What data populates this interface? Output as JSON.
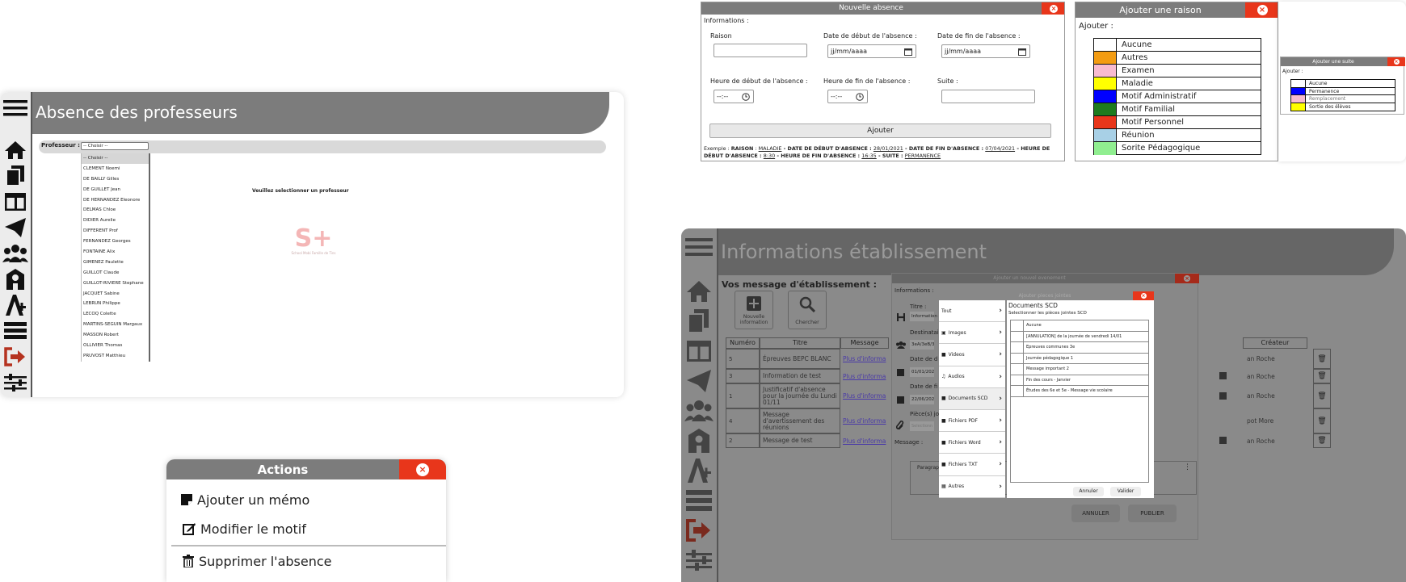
{
  "colors": {
    "accent": "#e8361b",
    "header": "#7c7c7c",
    "sidebar": "#ececec"
  },
  "absence_panel": {
    "title": "Absence des professeurs",
    "prof_label": "Professeur :",
    "select_value": "-- Choisir --",
    "options": [
      "-- Choisir --",
      "CLEMENT Noemi",
      "DE BAILLY Gilles",
      "DE GUILLET Jean",
      "DE HERNANDEZ Eleonore",
      "DELMAS Chloe",
      "DIDIER Aurelie",
      "DIFFERENT Prof",
      "FERNANDEZ Georges",
      "FONTAINE Alix",
      "GIMENEZ Paulette",
      "GUILLOT Claude",
      "GUILLOT-RIVIERE Stephane",
      "JACQUET Sabine",
      "LEBRUN Philippe",
      "LECOQ Colette",
      "MARTINS-SEGUIN Margaux",
      "MASSON Robert",
      "OLLIVIER Thomas",
      "PRUVOST Matthieu"
    ],
    "message": "Veuillez selectionner un professeur",
    "logo_text": "S+",
    "logo_caption": "School Mobi Famille de Tins"
  },
  "actions": {
    "title": "Actions",
    "items": [
      "Ajouter un mémo",
      "Modifier le motif",
      "Supprimer l'absence"
    ]
  },
  "nouvelle_absence": {
    "title": "Nouvelle absence",
    "section": "Informations :",
    "raison_label": "Raison",
    "date_debut_label": "Date de début de l'absence :",
    "date_fin_label": "Date de fin de l'absence :",
    "date_placeholder": "jj/mm/aaaa",
    "heure_debut_label": "Heure de début de l'absence :",
    "heure_fin_label": "Heure de fin de l'absence :",
    "time_placeholder": "--:--",
    "suite_label": "Suite :",
    "add_button": "Ajouter",
    "ex_prefix": "Exemple : ",
    "ex_raison_k": "RAISON",
    "ex_raison_v": "MALADIE",
    "ex_dd_k": " - DATE DE DÉBUT D'ABSENCE : ",
    "ex_dd_v": "28/01/2021",
    "ex_df_k": " - DATE DE FIN D'ABSENCE : ",
    "ex_df_v": "07/04/2021",
    "ex_hd_k": " - HEURE DE DÉBUT D'ABSENCE : ",
    "ex_hd_v": "8:30",
    "ex_hf_k": " - HEURE DE FIN D'ABSENCE : ",
    "ex_hf_v": "16:35",
    "ex_s_k": " - SUITE : ",
    "ex_s_v": "PERMANENCE"
  },
  "raison": {
    "title": "Ajouter une raison",
    "ajouter": "Ajouter :",
    "items": [
      {
        "label": "Aucune",
        "color": "#ffffff"
      },
      {
        "label": "Autres",
        "color": "#f39c12"
      },
      {
        "label": "Examen",
        "color": "#f8bbd0"
      },
      {
        "label": "Maladie",
        "color": "#ffff00"
      },
      {
        "label": "Motif Administratif",
        "color": "#0000ff"
      },
      {
        "label": "Motif Familial",
        "color": "#1e7b1e"
      },
      {
        "label": "Motif Personnel",
        "color": "#e8361b"
      },
      {
        "label": "Réunion",
        "color": "#a8d0e6"
      },
      {
        "label": "Sorite Pédagogique",
        "color": "#90ee90"
      }
    ]
  },
  "suite": {
    "title": "Ajouter une suite",
    "ajouter": "Ajouter :",
    "items": [
      {
        "label": "Aucune",
        "color": "#ffffff"
      },
      {
        "label": "Permanence",
        "color": "#0000ff"
      },
      {
        "label": "Remplacement",
        "color": "#f8bbd0"
      },
      {
        "label": "Sortie des élèves",
        "color": "#ffff00"
      }
    ]
  },
  "infos": {
    "title": "Informations établissement",
    "vos_message": "Vos message d'établissement :",
    "nouvelle_info": "Nouvelle information",
    "chercher": "Chercher",
    "columns": [
      "Numéro",
      "Titre",
      "Message",
      "Créateur"
    ],
    "rows": [
      {
        "num": "5",
        "titre": "Épreuves BEPC BLANC",
        "msg": "Plus d'informa",
        "createur": "an Roche"
      },
      {
        "num": "3",
        "titre": "Information de test",
        "msg": "Plus d'informa",
        "createur": "an Roche"
      },
      {
        "num": "1",
        "titre": "Justificatif d'absence pour la journée du Lundi 01/11",
        "msg": "Plus d'informa",
        "createur": "an Roche"
      },
      {
        "num": "4",
        "titre": "Message d'avertissement des réunions",
        "msg": "Plus d'informa",
        "createur": "pot More"
      },
      {
        "num": "2",
        "titre": "Message de test",
        "msg": "Plus d'informa",
        "createur": "an Roche"
      }
    ],
    "modal_title": "Ajouter un nouvel evenement",
    "modal_info": "Informations :",
    "titre": "Titre :",
    "titre_value": "Information",
    "destinataire": "Destinatai",
    "dest_value": "3eA/3eB/3",
    "date_d": "Date de d",
    "date_d_value": "01/01/202",
    "date_f": "Date de fi",
    "date_f_value": "22/06/202",
    "pieces": "Pièce(s) jo",
    "pieces_value": "Selectionn",
    "message": "Message :",
    "paragraph": "Paragrap",
    "annuler": "ANNULER",
    "publier": "PUBLIER",
    "pj_title": "Ajouter pieces jointes",
    "menu": [
      "Tout",
      "Images",
      "Videos",
      "Audios",
      "Documents SCD",
      "Fichiers PDF",
      "Fichiers Word",
      "Fichiers TXT",
      "Autres"
    ],
    "doc_title": "Documents SCD",
    "doc_sub": "Selectionner les pièces jointes SCD",
    "docs": [
      "Aucune",
      "[ANNULATION] de la journée de vendredi 14/01",
      "Epreuves communes 3e",
      "Journée pédagogique 1",
      "Message important 2",
      "Fin des cours - Janvier",
      "Études des 6e et 5e - Message vie scolaire"
    ],
    "btn_annuler": "Annuler",
    "btn_valider": "Valider"
  }
}
